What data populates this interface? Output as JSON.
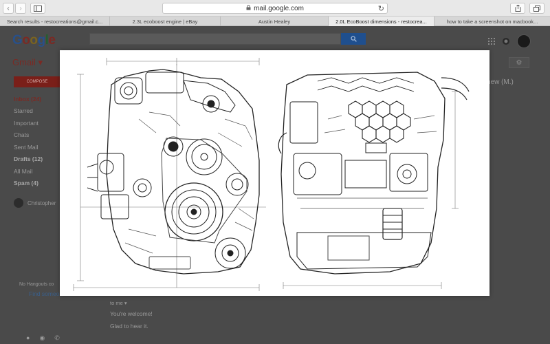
{
  "browser": {
    "url": "mail.google.com",
    "tabs": [
      {
        "label": "Search results - restocreations@gmail.c...",
        "active": false
      },
      {
        "label": "2.3L ecoboost engine | eBay",
        "active": false
      },
      {
        "label": "Austin Healey",
        "active": false
      },
      {
        "label": "2.0L EcoBoost dimensions - restocrea...",
        "active": true
      },
      {
        "label": "how to take a screenshot on macbook...",
        "active": false
      }
    ]
  },
  "gmail": {
    "logo": "Google",
    "app_label": "Gmail ▾",
    "compose_label": "COMPOSE",
    "nav": [
      {
        "label": "Inbox (24)",
        "style": "red"
      },
      {
        "label": "Starred",
        "style": "normal"
      },
      {
        "label": "Important",
        "style": "normal"
      },
      {
        "label": "Chats",
        "style": "normal"
      },
      {
        "label": "Sent Mail",
        "style": "normal"
      },
      {
        "label": "Drafts (12)",
        "style": "bold"
      },
      {
        "label": "All Mail",
        "style": "normal"
      },
      {
        "label": "Spam (4)",
        "style": "bold"
      }
    ],
    "contact": "Christopher",
    "reader": {
      "sender_fragment": "hew (M.)",
      "to_me": "to me ▾",
      "line1": "You're welcome!",
      "line2": "Glad to hear it."
    },
    "hangouts": {
      "notice": "No Hangouts co",
      "link": "Find someone"
    }
  },
  "viewer": {
    "image_name": "2.0L EcoBoost dimensions engine drawing"
  },
  "colors": {
    "google_blue": "#4285f4",
    "google_red": "#ea4335",
    "google_yellow": "#fbbc05",
    "google_green": "#34a853"
  }
}
